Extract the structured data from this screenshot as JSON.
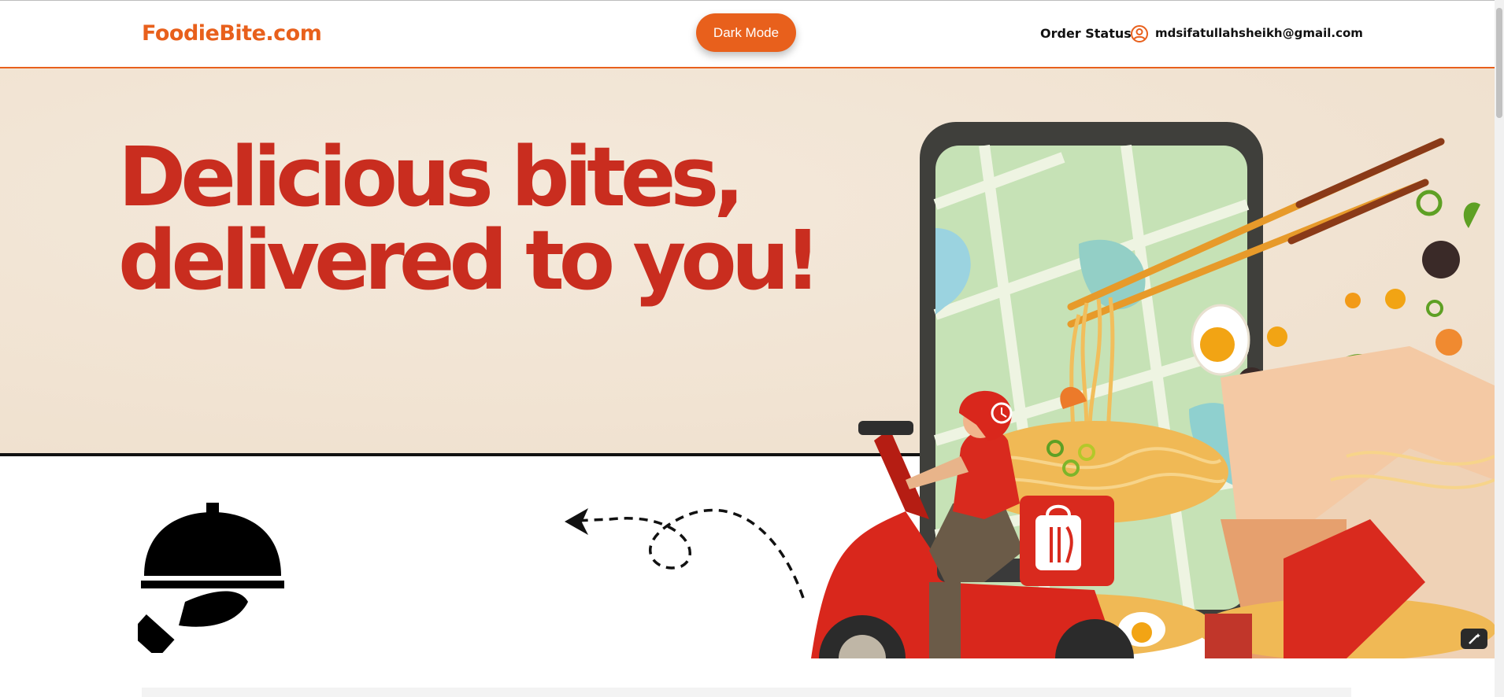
{
  "header": {
    "logo": "FoodieBite.com",
    "dark_mode_label": "Dark Mode",
    "order_status_label": "Order Status",
    "user_email": "mdsifatullahsheikh@gmail.com"
  },
  "hero": {
    "headline_line1": "Delicious bites,",
    "headline_line2": "delivered to you!"
  },
  "icons": {
    "user": "user-circle-icon",
    "cloche": "serving-cloche-icon",
    "arrow": "dashed-arrow-icon",
    "edit": "magic-edit-icon"
  },
  "colors": {
    "brand": "#e8601c",
    "headline": "#c92d1f",
    "hero_background": "#f1e3d2",
    "scooter": "#d9271c",
    "phone_frame": "#3f3f3b"
  }
}
